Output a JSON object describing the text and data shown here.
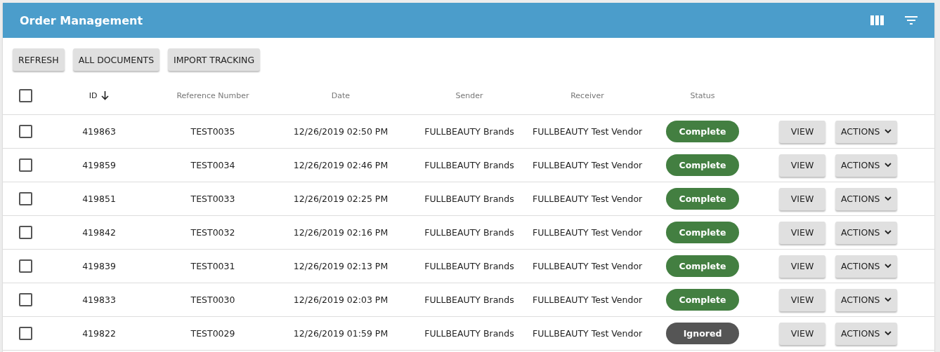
{
  "header": {
    "title": "Order Management"
  },
  "toolbar": [
    "REFRESH",
    "ALL DOCUMENTS",
    "IMPORT TRACKING"
  ],
  "table": {
    "select_all": {
      "checked": false
    },
    "columns": [
      {
        "label": "ID",
        "sorted": true
      },
      {
        "label": "Reference Number",
        "sorted": false
      },
      {
        "label": "Date",
        "sorted": false
      },
      {
        "label": "Sender",
        "sorted": false
      },
      {
        "label": "Receiver",
        "sorted": false
      },
      {
        "label": "Status",
        "sorted": false
      }
    ],
    "rows": [
      {
        "checked": false,
        "id": "419863",
        "reference": "TEST0035",
        "date": "12/26/2019 02:50 PM",
        "sender": "FULLBEAUTY Brands",
        "receiver": "FULLBEAUTY Test Vendor",
        "status": {
          "label": "Complete",
          "kind": "complete"
        },
        "view": "VIEW",
        "actions": "ACTIONS"
      },
      {
        "checked": false,
        "id": "419859",
        "reference": "TEST0034",
        "date": "12/26/2019 02:46 PM",
        "sender": "FULLBEAUTY Brands",
        "receiver": "FULLBEAUTY Test Vendor",
        "status": {
          "label": "Complete",
          "kind": "complete"
        },
        "view": "VIEW",
        "actions": "ACTIONS"
      },
      {
        "checked": false,
        "id": "419851",
        "reference": "TEST0033",
        "date": "12/26/2019 02:25 PM",
        "sender": "FULLBEAUTY Brands",
        "receiver": "FULLBEAUTY Test Vendor",
        "status": {
          "label": "Complete",
          "kind": "complete"
        },
        "view": "VIEW",
        "actions": "ACTIONS"
      },
      {
        "checked": false,
        "id": "419842",
        "reference": "TEST0032",
        "date": "12/26/2019 02:16 PM",
        "sender": "FULLBEAUTY Brands",
        "receiver": "FULLBEAUTY Test Vendor",
        "status": {
          "label": "Complete",
          "kind": "complete"
        },
        "view": "VIEW",
        "actions": "ACTIONS"
      },
      {
        "checked": false,
        "id": "419839",
        "reference": "TEST0031",
        "date": "12/26/2019 02:13 PM",
        "sender": "FULLBEAUTY Brands",
        "receiver": "FULLBEAUTY Test Vendor",
        "status": {
          "label": "Complete",
          "kind": "complete"
        },
        "view": "VIEW",
        "actions": "ACTIONS"
      },
      {
        "checked": false,
        "id": "419833",
        "reference": "TEST0030",
        "date": "12/26/2019 02:03 PM",
        "sender": "FULLBEAUTY Brands",
        "receiver": "FULLBEAUTY Test Vendor",
        "status": {
          "label": "Complete",
          "kind": "complete"
        },
        "view": "VIEW",
        "actions": "ACTIONS"
      },
      {
        "checked": false,
        "id": "419822",
        "reference": "TEST0029",
        "date": "12/26/2019 01:59 PM",
        "sender": "FULLBEAUTY Brands",
        "receiver": "FULLBEAUTY Test Vendor",
        "status": {
          "label": "Ignored",
          "kind": "ignored"
        },
        "view": "VIEW",
        "actions": "ACTIONS"
      }
    ]
  }
}
